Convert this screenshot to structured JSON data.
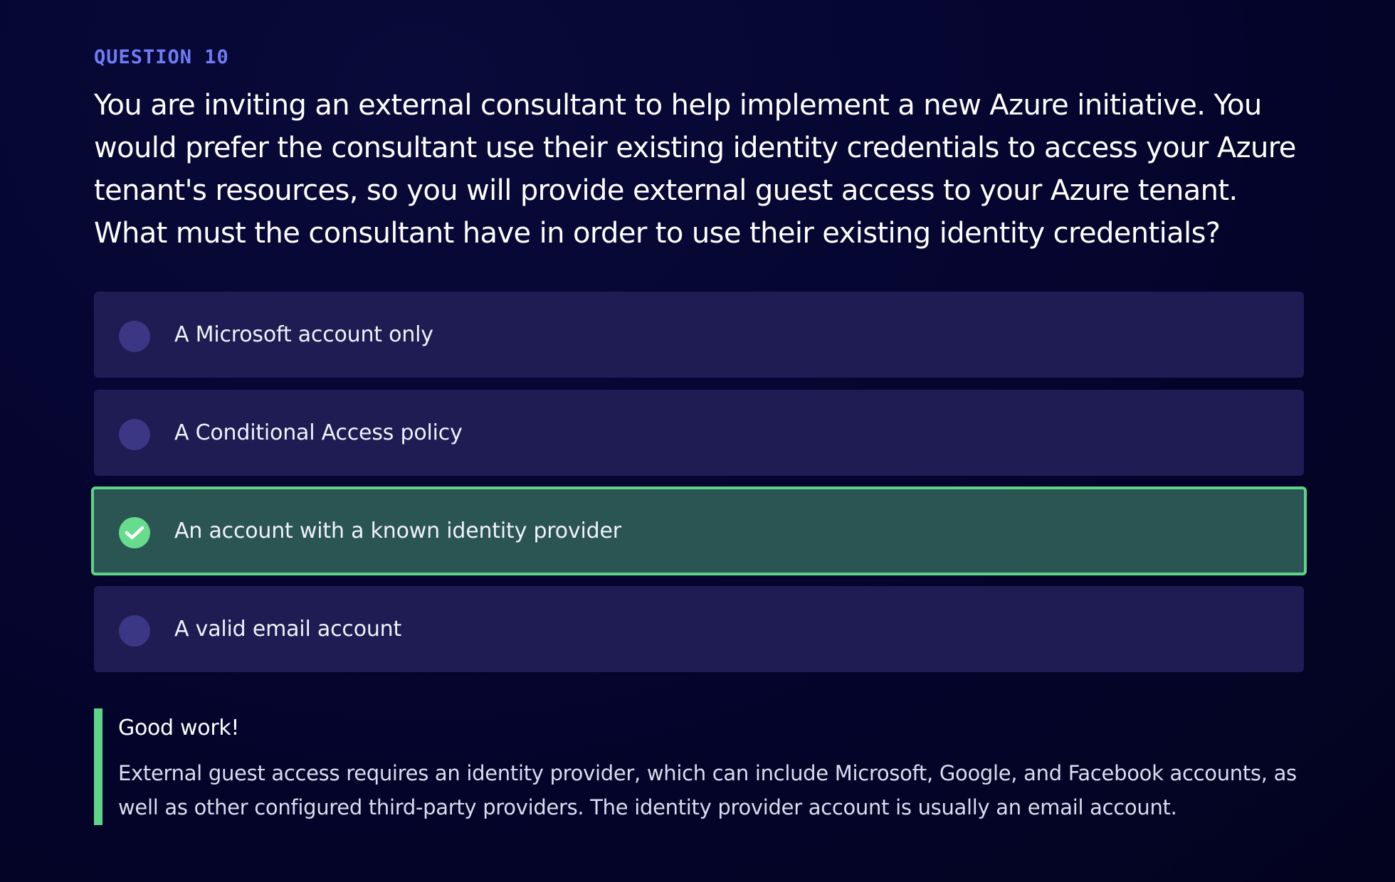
{
  "question": {
    "label": "QUESTION 10",
    "text": "You are inviting an external consultant to help implement a new Azure initiative. You would prefer the consultant use their existing identity credentials to access your Azure tenant's resources, so you will provide external guest access to your Azure tenant. What must the consultant have in order to use their existing identity credentials?"
  },
  "options": [
    {
      "label": "A Microsoft account only",
      "state": "unselected"
    },
    {
      "label": "A Conditional Access policy",
      "state": "unselected"
    },
    {
      "label": "An account with a known identity provider",
      "state": "correct"
    },
    {
      "label": "A valid email account",
      "state": "unselected"
    }
  ],
  "feedback": {
    "title": "Good work!",
    "body": "External guest access requires an identity provider, which can include Microsoft, Google, and Facebook accounts, as well as other configured third-party providers. The identity provider account is usually an email account."
  },
  "colors": {
    "accent": "#6f7cf5",
    "correct": "#5fd488",
    "option_bg": "#1f1c53",
    "correct_bg": "#2a5553"
  },
  "icons": {
    "correct_option": "check-circle-icon",
    "unselected_option": "radio-circle-icon"
  }
}
